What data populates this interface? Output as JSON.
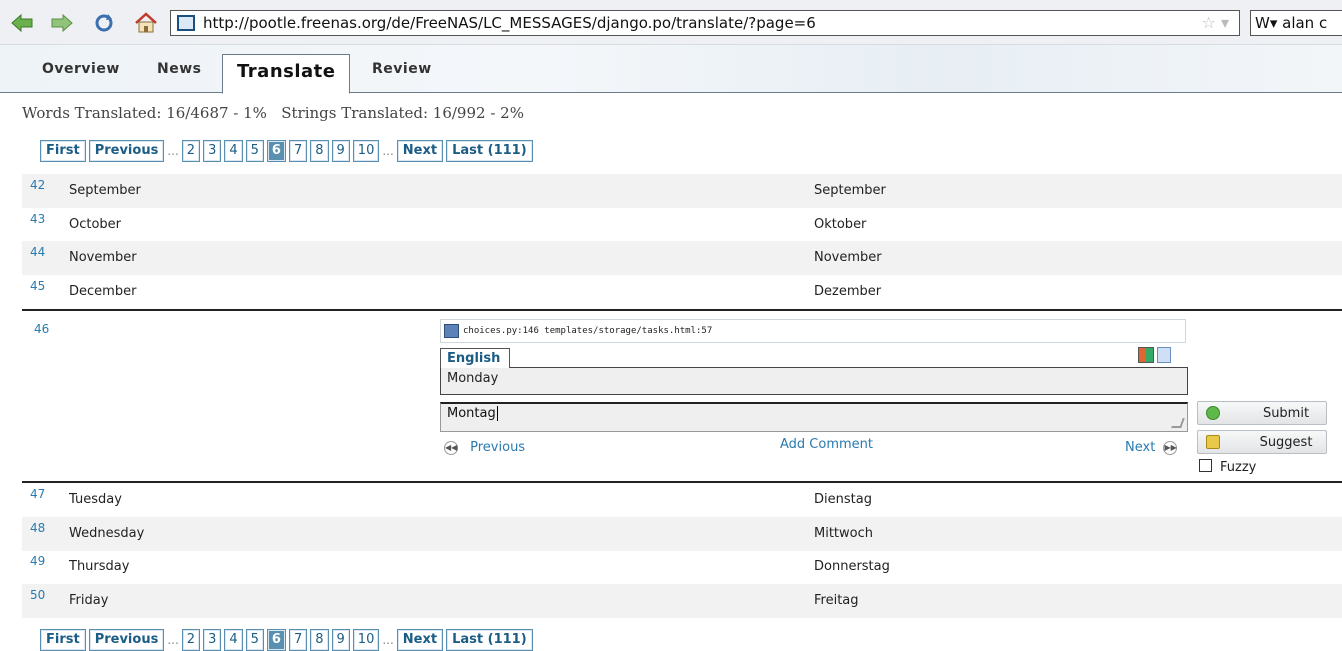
{
  "browser": {
    "url": "http://pootle.freenas.org/de/FreeNAS/LC_MESSAGES/django.po/translate/?page=6",
    "search_text": "W▾ alan c"
  },
  "tabs": [
    {
      "label": "Overview"
    },
    {
      "label": "News"
    },
    {
      "label": "Translate"
    },
    {
      "label": "Review"
    }
  ],
  "stats": "Words Translated: 16/4687 - 1%   Strings Translated: 16/992 - 2%",
  "pager": {
    "first": "First",
    "previous": "Previous",
    "ellipsis": "...",
    "pages": [
      "2",
      "3",
      "4",
      "5",
      "6",
      "7",
      "8",
      "9",
      "10"
    ],
    "current": "6",
    "next": "Next",
    "last": "Last (111)"
  },
  "rows_before": [
    {
      "num": "42",
      "source": "September",
      "target": "September"
    },
    {
      "num": "43",
      "source": "October",
      "target": "Oktober"
    },
    {
      "num": "44",
      "source": "November",
      "target": "November"
    },
    {
      "num": "45",
      "source": "December",
      "target": "Dezember"
    }
  ],
  "editor": {
    "num": "46",
    "location": "choices.py:146 templates/storage/tasks.html:57",
    "lang_tab": "English",
    "original": "Monday",
    "translation": "Montag",
    "prev_label": "Previous",
    "add_comment": "Add Comment",
    "next_label": "Next",
    "submit": "Submit",
    "suggest": "Suggest",
    "fuzzy": "Fuzzy"
  },
  "rows_after": [
    {
      "num": "47",
      "source": "Tuesday",
      "target": "Dienstag"
    },
    {
      "num": "48",
      "source": "Wednesday",
      "target": "Mittwoch"
    },
    {
      "num": "49",
      "source": "Thursday",
      "target": "Donnerstag"
    },
    {
      "num": "50",
      "source": "Friday",
      "target": "Freitag"
    }
  ],
  "colors": {
    "link": "#2a7ab0",
    "pager_border": "#5b8fb0",
    "row_alt": "#f2f2f2"
  }
}
